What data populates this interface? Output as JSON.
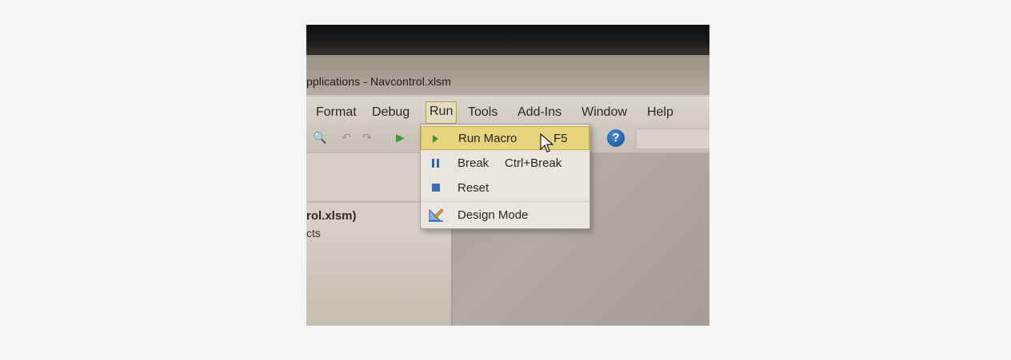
{
  "window": {
    "title": "pplications - Navcontrol.xlsm"
  },
  "menubar": {
    "items": [
      {
        "label": "Format",
        "name": "menu-format"
      },
      {
        "label": "Debug",
        "name": "menu-debug"
      },
      {
        "label": "Run",
        "name": "menu-run"
      },
      {
        "label": "Tools",
        "name": "menu-tools"
      },
      {
        "label": "Add-Ins",
        "name": "menu-add-ins"
      },
      {
        "label": "Window",
        "name": "menu-window"
      },
      {
        "label": "Help",
        "name": "menu-help"
      }
    ]
  },
  "toolbar": {
    "help_glyph": "?"
  },
  "project_pane": {
    "project_label": "rol.xlsm)",
    "objects_label": "cts"
  },
  "run_menu": {
    "items": [
      {
        "label": "Run Macro",
        "shortcut": "F5",
        "icon": "play-icon",
        "highlighted": true
      },
      {
        "label": "Break",
        "shortcut": "Ctrl+Break",
        "icon": "pause-icon",
        "highlighted": false
      },
      {
        "label": "Reset",
        "shortcut": "",
        "icon": "stop-icon",
        "highlighted": false
      },
      {
        "label": "Design Mode",
        "shortcut": "",
        "icon": "design-mode-icon",
        "highlighted": false
      }
    ]
  },
  "colors": {
    "menu_highlight": "#e7d27e",
    "run_green": "#3a9a32",
    "help_blue": "#1e5ba6"
  }
}
